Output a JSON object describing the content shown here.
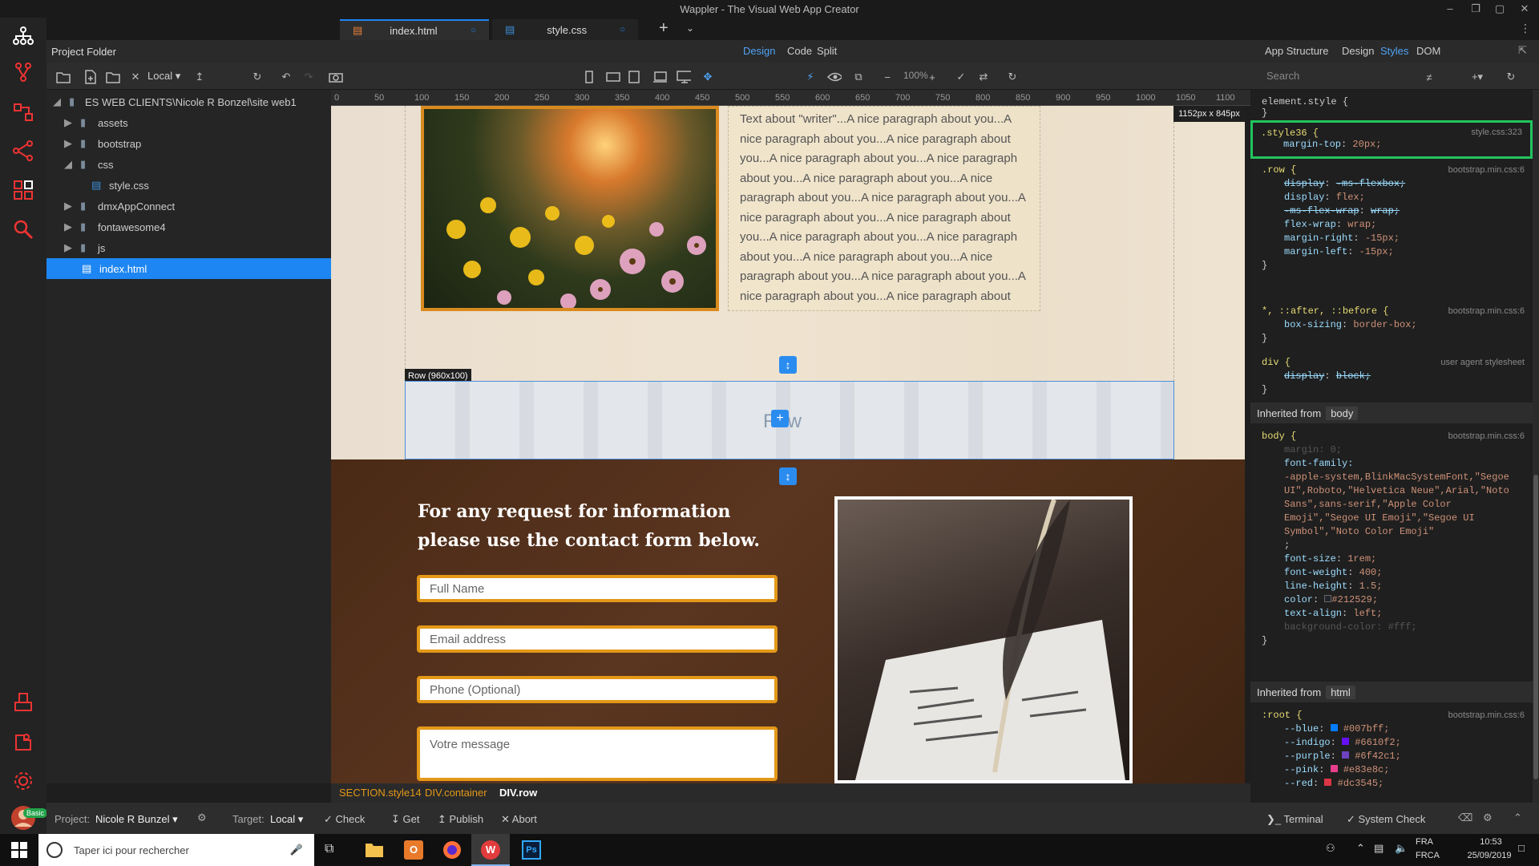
{
  "window": {
    "title": "Wappler - The Visual Web App Creator"
  },
  "tabs": [
    {
      "label": "index.html"
    },
    {
      "label": "style.css"
    }
  ],
  "project": {
    "header": "Project Folder"
  },
  "view_switch": {
    "design": "Design",
    "code": "Code",
    "split": "Split"
  },
  "right_header": {
    "app_structure": "App Structure",
    "design": "Design",
    "styles": "Styles",
    "dom": "DOM"
  },
  "toolbar": {
    "target": "Local",
    "zoom": "100%",
    "search_placeholder": "Search"
  },
  "tree": [
    {
      "label": "ES WEB CLIENTS\\Nicole R Bonzel\\site web1"
    },
    {
      "label": "assets"
    },
    {
      "label": "bootstrap"
    },
    {
      "label": "css"
    },
    {
      "label": "style.css"
    },
    {
      "label": "dmxAppConnect"
    },
    {
      "label": "fontawesome4"
    },
    {
      "label": "js"
    },
    {
      "label": "index.html"
    }
  ],
  "ruler": {
    "ticks": [
      "0",
      "50",
      "100",
      "150",
      "200",
      "250",
      "300",
      "350",
      "400",
      "450",
      "500",
      "550",
      "600",
      "650",
      "700",
      "750",
      "800",
      "850",
      "900",
      "950",
      "1000",
      "1050",
      "1100"
    ],
    "size_badge": "1152px x 845px"
  },
  "canvas": {
    "about_text": "Text about \"writer\"...A nice paragraph about you...A nice paragraph about you...A nice paragraph about you...A nice paragraph about you...A nice paragraph about you...A nice paragraph about you...A nice paragraph about you...A nice paragraph about you...A nice paragraph about you...A nice paragraph about you...A nice paragraph about you...A nice paragraph about you...A nice paragraph about you...A nice paragraph about you...A nice paragraph about you...A nice paragraph about you...A nice paragraph about you...A nice paragraph about you...A nice paragraph about you...A nice paragraph about you...A nice paragraph about you...A nice paragraph about you...A nice paragraph about you...A nice paragraph about you...A nice paragraph about you...A nice paragraph about you...",
    "row_badge": "Row (960x100)",
    "row_placeholder": "Row",
    "contact_heading": "For any request for information please use the contact form below.",
    "fields": {
      "full_name": "Full Name",
      "email": "Email address",
      "phone": "Phone (Optional)",
      "message": "Votre message"
    }
  },
  "path": [
    "SECTION.style14",
    "DIV.container",
    "DIV.row"
  ],
  "styles": {
    "element_style": "element.style {",
    "style36": {
      "selector": ".style36 {",
      "source": "style.css:323",
      "prop": "margin-top",
      "val": "20px;"
    },
    "row": {
      "selector": ".row {",
      "source": "bootstrap.min.css:6",
      "props": [
        {
          "p": "display",
          "v": "-ms-flexbox;",
          "struck": true
        },
        {
          "p": "display",
          "v": "flex;",
          "struck": false
        },
        {
          "p": "-ms-flex-wrap",
          "v": "wrap;",
          "struck": true
        },
        {
          "p": "flex-wrap",
          "v": "wrap;",
          "struck": false
        },
        {
          "p": "margin-right",
          "v": "-15px;",
          "struck": false
        },
        {
          "p": "margin-left",
          "v": "-15px;",
          "struck": false
        }
      ]
    },
    "box": {
      "selector": "*, ::after, ::before {",
      "source": "bootstrap.min.css:6",
      "prop": "box-sizing",
      "val": "border-box;"
    },
    "div": {
      "selector": "div {",
      "source": "user agent stylesheet",
      "prop": "display",
      "val": "block;"
    },
    "inherited_body": {
      "label": "Inherited from",
      "tag": "body"
    },
    "body": {
      "selector": "body {",
      "source": "bootstrap.min.css:6",
      "margin": "margin: 0;",
      "font_family_prop": "font-family:",
      "font_family_val": "-apple-system,BlinkMacSystemFont,\"Segoe UI\",Roboto,\"Helvetica Neue\",Arial,\"Noto Sans\",sans-serif,\"Apple Color Emoji\",\"Segoe UI Emoji\",\"Segoe UI Symbol\",\"Noto Color Emoji\"",
      "semicolon": ";",
      "font_size": "1rem;",
      "font_weight": "400;",
      "line_height": "1.5;",
      "color": "#212529;",
      "text_align": "left;",
      "bg": "background-color: #fff;"
    },
    "inherited_html": {
      "label": "Inherited from",
      "tag": "html"
    },
    "root": {
      "selector": ":root {",
      "source": "bootstrap.min.css:6",
      "vars": [
        {
          "p": "--blue",
          "v": "#007bff;",
          "c": "#007bff"
        },
        {
          "p": "--indigo",
          "v": "#6610f2;",
          "c": "#6610f2"
        },
        {
          "p": "--purple",
          "v": "#6f42c1;",
          "c": "#6f42c1"
        },
        {
          "p": "--pink",
          "v": "#e83e8c;",
          "c": "#e83e8c"
        },
        {
          "p": "--red",
          "v": "#dc3545;",
          "c": "#dc3545"
        }
      ]
    }
  },
  "bottombar": {
    "project_label": "Project:",
    "project_name": "Nicole R Bunzel",
    "target_label": "Target:",
    "target_value": "Local",
    "check": "Check",
    "get": "Get",
    "publish": "Publish",
    "abort": "Abort",
    "terminal": "Terminal",
    "system_check": "System Check",
    "badge": "Basic"
  },
  "taskbar": {
    "search_placeholder": "Taper ici pour rechercher",
    "lang1": "FRA",
    "lang2": "FRCA",
    "time": "10:53",
    "date": "25/09/2019"
  },
  "colors": {
    "accent": "#1e86f2",
    "highlight_box": "#22c55e",
    "form_border": "#e39818"
  }
}
